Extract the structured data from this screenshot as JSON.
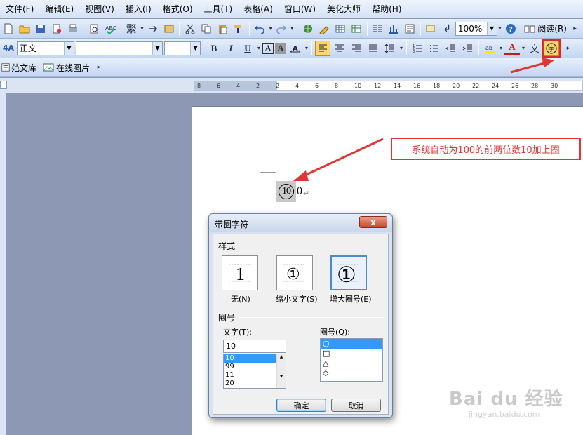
{
  "menu": [
    "文件(F)",
    "编辑(E)",
    "视图(V)",
    "插入(I)",
    "格式(O)",
    "工具(T)",
    "表格(A)",
    "窗口(W)",
    "美化大师",
    "帮助(H)"
  ],
  "toolbar1": {
    "traditional_label": "繁",
    "zoom_value": "100%",
    "read_label": "阅读(R)"
  },
  "toolbar2": {
    "style_value": "正文",
    "font_value": "",
    "size_value": "",
    "bold": "B",
    "italic": "I",
    "underline": "U",
    "char_border": "A",
    "char_shading": "A",
    "font_color": "A",
    "phonetic": "文",
    "enclose_char_icon": "字"
  },
  "toolbar3": {
    "template_library": "范文库",
    "online_images": "在线图片"
  },
  "ruler_ticks": [
    "8",
    "6",
    "4",
    "2",
    "2",
    "4",
    "6",
    "8",
    "10",
    "12",
    "14",
    "16",
    "18",
    "20",
    "22",
    "24",
    "26",
    "28",
    "30"
  ],
  "document": {
    "enclosed_text": "10",
    "rest_text": "0",
    "para_mark": "↵"
  },
  "annotation": "系统自动为100的前两位数10加上圈",
  "dialog": {
    "title": "带圈字符",
    "close": "x",
    "style_group": "样式",
    "styles": [
      {
        "preview": "1",
        "label": "无(N)"
      },
      {
        "preview": "①",
        "label": "缩小文字(S)"
      },
      {
        "preview": "①",
        "label": "增大圈号(E)"
      }
    ],
    "enclose_group": "圈号",
    "text_label": "文字(T):",
    "text_value": "10",
    "text_options": [
      "10",
      "99",
      "11",
      "20"
    ],
    "enclosure_label": "圈号(Q):",
    "enclosures": [
      "○",
      "□",
      "△",
      "◇"
    ],
    "ok": "确定",
    "cancel": "取消"
  },
  "watermark": "Bai du 经验",
  "watermark_sub": "jingyan.baidu.com"
}
